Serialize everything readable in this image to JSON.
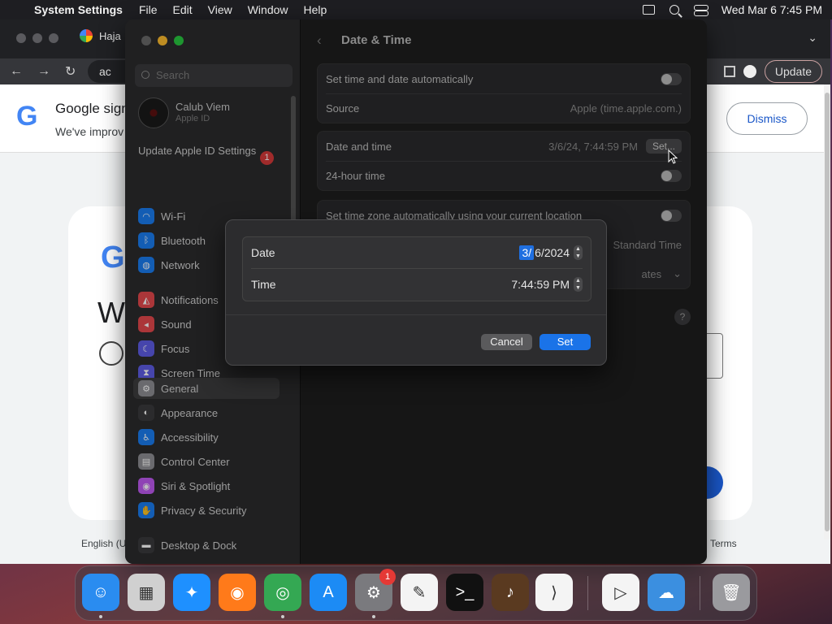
{
  "menubar": {
    "app_name": "System Settings",
    "menus": [
      "File",
      "Edit",
      "View",
      "Window",
      "Help"
    ],
    "clock": "Wed Mar 6  7:45 PM"
  },
  "chrome": {
    "tab_title": "Haja",
    "omnibox_text": "ac",
    "update_label": "Update",
    "banner_title": "Google sign",
    "banner_text": "We've improv",
    "dismiss_label": "Dismiss",
    "card_heading": "W",
    "footer_lang": "English (U",
    "footer_terms": "Terms"
  },
  "sidebar": {
    "search_placeholder": "Search",
    "account_name": "Calub Viem",
    "account_sub": "Apple ID",
    "update_label": "Update Apple ID Settings",
    "update_badge": "1",
    "items": [
      {
        "label": "Wi-Fi",
        "icon": "wifi-icon",
        "color": "#1a7cf0"
      },
      {
        "label": "Bluetooth",
        "icon": "bluetooth-icon",
        "color": "#1a7cf0"
      },
      {
        "label": "Network",
        "icon": "globe-icon",
        "color": "#1a7cf0"
      },
      {
        "label": "Notifications",
        "icon": "bell-icon",
        "color": "#e5484d"
      },
      {
        "label": "Sound",
        "icon": "speaker-icon",
        "color": "#e5484d"
      },
      {
        "label": "Focus",
        "icon": "moon-icon",
        "color": "#5e5ce6"
      },
      {
        "label": "Screen Time",
        "icon": "hourglass-icon",
        "color": "#5e5ce6"
      },
      {
        "label": "General",
        "icon": "gear-icon",
        "color": "#8e8e93"
      },
      {
        "label": "Appearance",
        "icon": "appearance-icon",
        "color": "#3a3a3c"
      },
      {
        "label": "Accessibility",
        "icon": "accessibility-icon",
        "color": "#1a7cf0"
      },
      {
        "label": "Control Center",
        "icon": "control-center-icon",
        "color": "#8e8e93"
      },
      {
        "label": "Siri & Spotlight",
        "icon": "siri-icon",
        "color": "#bf5af2"
      },
      {
        "label": "Privacy & Security",
        "icon": "hand-icon",
        "color": "#1a7cf0"
      },
      {
        "label": "Desktop & Dock",
        "icon": "dock-icon",
        "color": "#3a3a3c"
      }
    ]
  },
  "content": {
    "title": "Date & Time",
    "auto_time_label": "Set time and date automatically",
    "source_label": "Source",
    "source_value": "Apple (time.apple.com.)",
    "date_time_label": "Date and time",
    "date_time_value": "3/6/24, 7:44:59 PM",
    "set_label": "Set...",
    "hour24_label": "24-hour time",
    "tz_auto_label": "Set time zone automatically using your current location",
    "tz_value_partial": "Standard Time",
    "city_partial": "ates",
    "help": "?"
  },
  "sheet": {
    "date_label": "Date",
    "date_month": "3/",
    "date_rest": " 6/2024",
    "time_label": "Time",
    "time_value": "7:44:59 PM",
    "cancel_label": "Cancel",
    "set_label": "Set"
  },
  "dock": {
    "items": [
      {
        "name": "finder",
        "color": "#2a8cf0",
        "glyph": "☺"
      },
      {
        "name": "launchpad",
        "color": "#d0d0d0",
        "glyph": "▦"
      },
      {
        "name": "safari",
        "color": "#1e90ff",
        "glyph": "✦"
      },
      {
        "name": "firefox",
        "color": "#ff7a1a",
        "glyph": "◉"
      },
      {
        "name": "chrome",
        "color": "#34a853",
        "glyph": "◎"
      },
      {
        "name": "app-store",
        "color": "#1c8bf5",
        "glyph": "A"
      },
      {
        "name": "system-settings",
        "color": "#7a7a7e",
        "glyph": "⚙"
      },
      {
        "name": "textedit",
        "color": "#f4f4f4",
        "glyph": "✎"
      },
      {
        "name": "terminal",
        "color": "#111111",
        "glyph": ">_"
      },
      {
        "name": "garageband",
        "color": "#5a3a20",
        "glyph": "♪"
      },
      {
        "name": "vscode",
        "color": "#f4f4f4",
        "glyph": "⟩"
      },
      {
        "name": "visual-studio",
        "color": "#f4f4f4",
        "glyph": "▷"
      },
      {
        "name": "weather",
        "color": "#3b8fe0",
        "glyph": "☁"
      },
      {
        "name": "trash",
        "color": "#9a9a9e",
        "glyph": "🗑"
      }
    ],
    "settings_badge": "1"
  }
}
